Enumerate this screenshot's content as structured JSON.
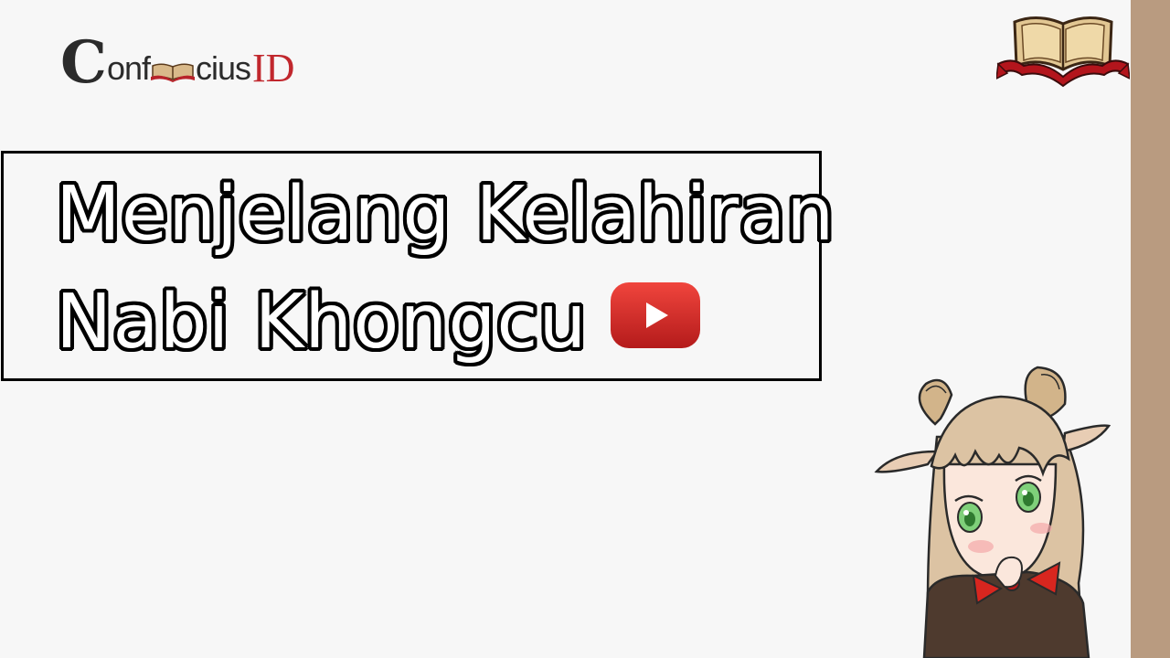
{
  "logo": {
    "c_letter": "C",
    "text_before": "onf",
    "text_after": "cius",
    "id_text": "ID"
  },
  "title": {
    "line1": "Menjelang Kelahiran",
    "line2": "Nabi Khongcu"
  },
  "icons": {
    "video": "youtube-play-icon",
    "book": "open-book-icon"
  },
  "colors": {
    "background": "#f7f7f7",
    "strip": "#b99b80",
    "logo_accent": "#c1272d",
    "youtube_red": "#e52d27"
  }
}
